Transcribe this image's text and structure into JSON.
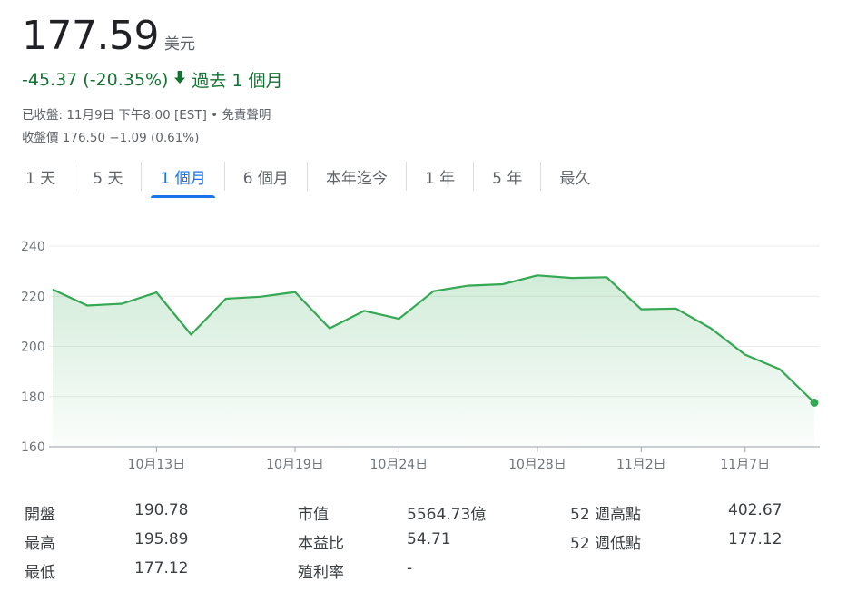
{
  "quote": {
    "price": "177.59",
    "currency": "美元",
    "change": "-45.37 (-20.35%)",
    "arrow_icon": "arrow-down-icon",
    "period": "過去 1 個月",
    "status_line": "已收盤: 11月9日 下午8:00 [EST] • ",
    "disclaimer_link": "免責聲明",
    "close_line": "收盤價 176.50 −1.09 (0.61%)",
    "change_color": "#137333"
  },
  "tabs": [
    {
      "label": "1 天"
    },
    {
      "label": "5 天"
    },
    {
      "label": "1 個月",
      "active": true
    },
    {
      "label": "6 個月"
    },
    {
      "label": "本年迄今"
    },
    {
      "label": "1 年"
    },
    {
      "label": "5 年"
    },
    {
      "label": "最久"
    }
  ],
  "chart_data": {
    "type": "area",
    "color": "#34a853",
    "ylim": [
      160,
      240
    ],
    "yticks": [
      "160",
      "180",
      "200",
      "220",
      "240"
    ],
    "xticks": [
      "10月13日",
      "10月19日",
      "10月24日",
      "10月28日",
      "11月2日",
      "11月7日"
    ],
    "values": [
      222.7,
      216.3,
      217.0,
      221.5,
      204.7,
      219.0,
      219.8,
      221.7,
      207.2,
      214.2,
      211.0,
      222.0,
      224.2,
      224.8,
      228.3,
      227.3,
      227.6,
      214.8,
      215.1,
      207.3,
      196.7,
      190.9,
      177.59
    ],
    "grid": true
  },
  "stats": {
    "open_label": "開盤",
    "open_value": "190.78",
    "high_label": "最高",
    "high_value": "195.89",
    "low_label": "最低",
    "low_value": "177.12",
    "mktcap_label": "市值",
    "mktcap_value": "5564.73億",
    "pe_label": "本益比",
    "pe_value": "54.71",
    "yield_label": "殖利率",
    "yield_value": "-",
    "wk52_high_label": "52 週高點",
    "wk52_high_value": "402.67",
    "wk52_low_label": "52 週低點",
    "wk52_low_value": "177.12"
  }
}
